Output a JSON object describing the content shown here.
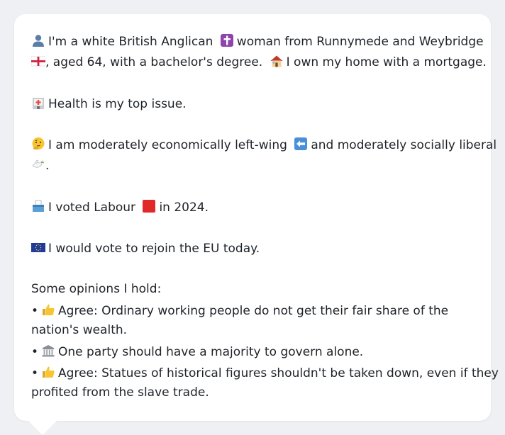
{
  "message": {
    "identity_line1_a": "I'm a white British Anglican",
    "identity_line1_b": "woman from Runnymede and Weybridge",
    "identity_line2_a": ", aged 64, with a bachelor's degree.",
    "identity_line2_b": "I own my home with a mortgage.",
    "health": "Health is my top issue.",
    "econ_line1_a": "I am moderately economically left-wing",
    "econ_line1_b": "and moderately socially liberal",
    "econ_line2": ".",
    "voted": "I voted Labour",
    "voted_year": "in 2024.",
    "eu": "I would vote to rejoin the EU today.",
    "opinions_header": "Some opinions I hold:",
    "bullet": "•",
    "op1_line1": "Agree: Ordinary working people do not get their fair share of the",
    "op1_line2": "nation's wealth.",
    "op2": "One party should have a majority to govern alone.",
    "op3_line1": "Agree: Statues of historical figures shouldn't be taken down, even if they",
    "op3_line2": "profited from the slave trade."
  },
  "icons": {
    "person": "person-icon",
    "cross": "latin-cross-icon",
    "england_flag": "england-flag-icon",
    "house": "house-icon",
    "hospital": "hospital-icon",
    "thinking": "thinking-face-icon",
    "left_arrow": "left-arrow-icon",
    "dove": "dove-icon",
    "ballot": "ballot-box-icon",
    "red_square": "red-square-icon",
    "eu_flag": "eu-flag-icon",
    "thumbs_up": "thumbs-up-icon",
    "classical_building": "classical-building-icon"
  }
}
